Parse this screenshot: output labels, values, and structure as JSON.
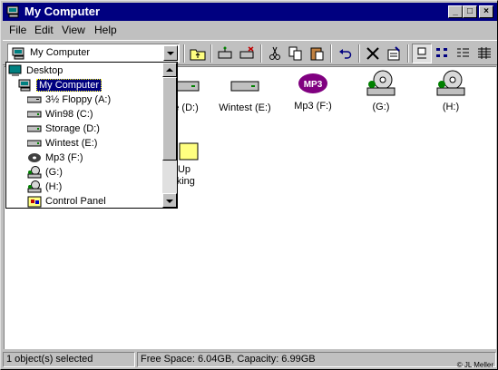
{
  "window": {
    "title": "My Computer"
  },
  "menu": {
    "file": "File",
    "edit": "Edit",
    "view": "View",
    "help": "Help"
  },
  "address": {
    "value": "My Computer"
  },
  "dropdown": {
    "items": [
      {
        "label": "Desktop",
        "icon": "desktop-icon"
      },
      {
        "label": "My Computer",
        "icon": "computer-icon"
      },
      {
        "label": "3½ Floppy (A:)",
        "icon": "floppy-icon"
      },
      {
        "label": "Win98 (C:)",
        "icon": "drive-icon"
      },
      {
        "label": "Storage (D:)",
        "icon": "drive-icon"
      },
      {
        "label": "Wintest (E:)",
        "icon": "drive-icon"
      },
      {
        "label": "Mp3 (F:)",
        "icon": "cd-icon"
      },
      {
        "label": "(G:)",
        "icon": "cd-drive-icon"
      },
      {
        "label": "(H:)",
        "icon": "cd-drive-icon"
      },
      {
        "label": "Control Panel",
        "icon": "control-panel-icon"
      }
    ]
  },
  "icons": {
    "storage_label_partial": "e (D:)",
    "wintest_label": "Wintest (E:)",
    "mp3_label": "Mp3 (F:)",
    "mp3_badge": "MP3",
    "g_label": "(G:)",
    "h_label": "(H:)",
    "dialup_label_1": "Up",
    "dialup_label_2": "rking"
  },
  "status": {
    "selected": "1 object(s) selected",
    "space": "Free Space: 6.04GB,  Capacity: 6.99GB"
  },
  "credit": "© JL Meller",
  "colors": {
    "titlebar": "#000080",
    "face": "#c0c0c0",
    "selection": "#000080"
  }
}
